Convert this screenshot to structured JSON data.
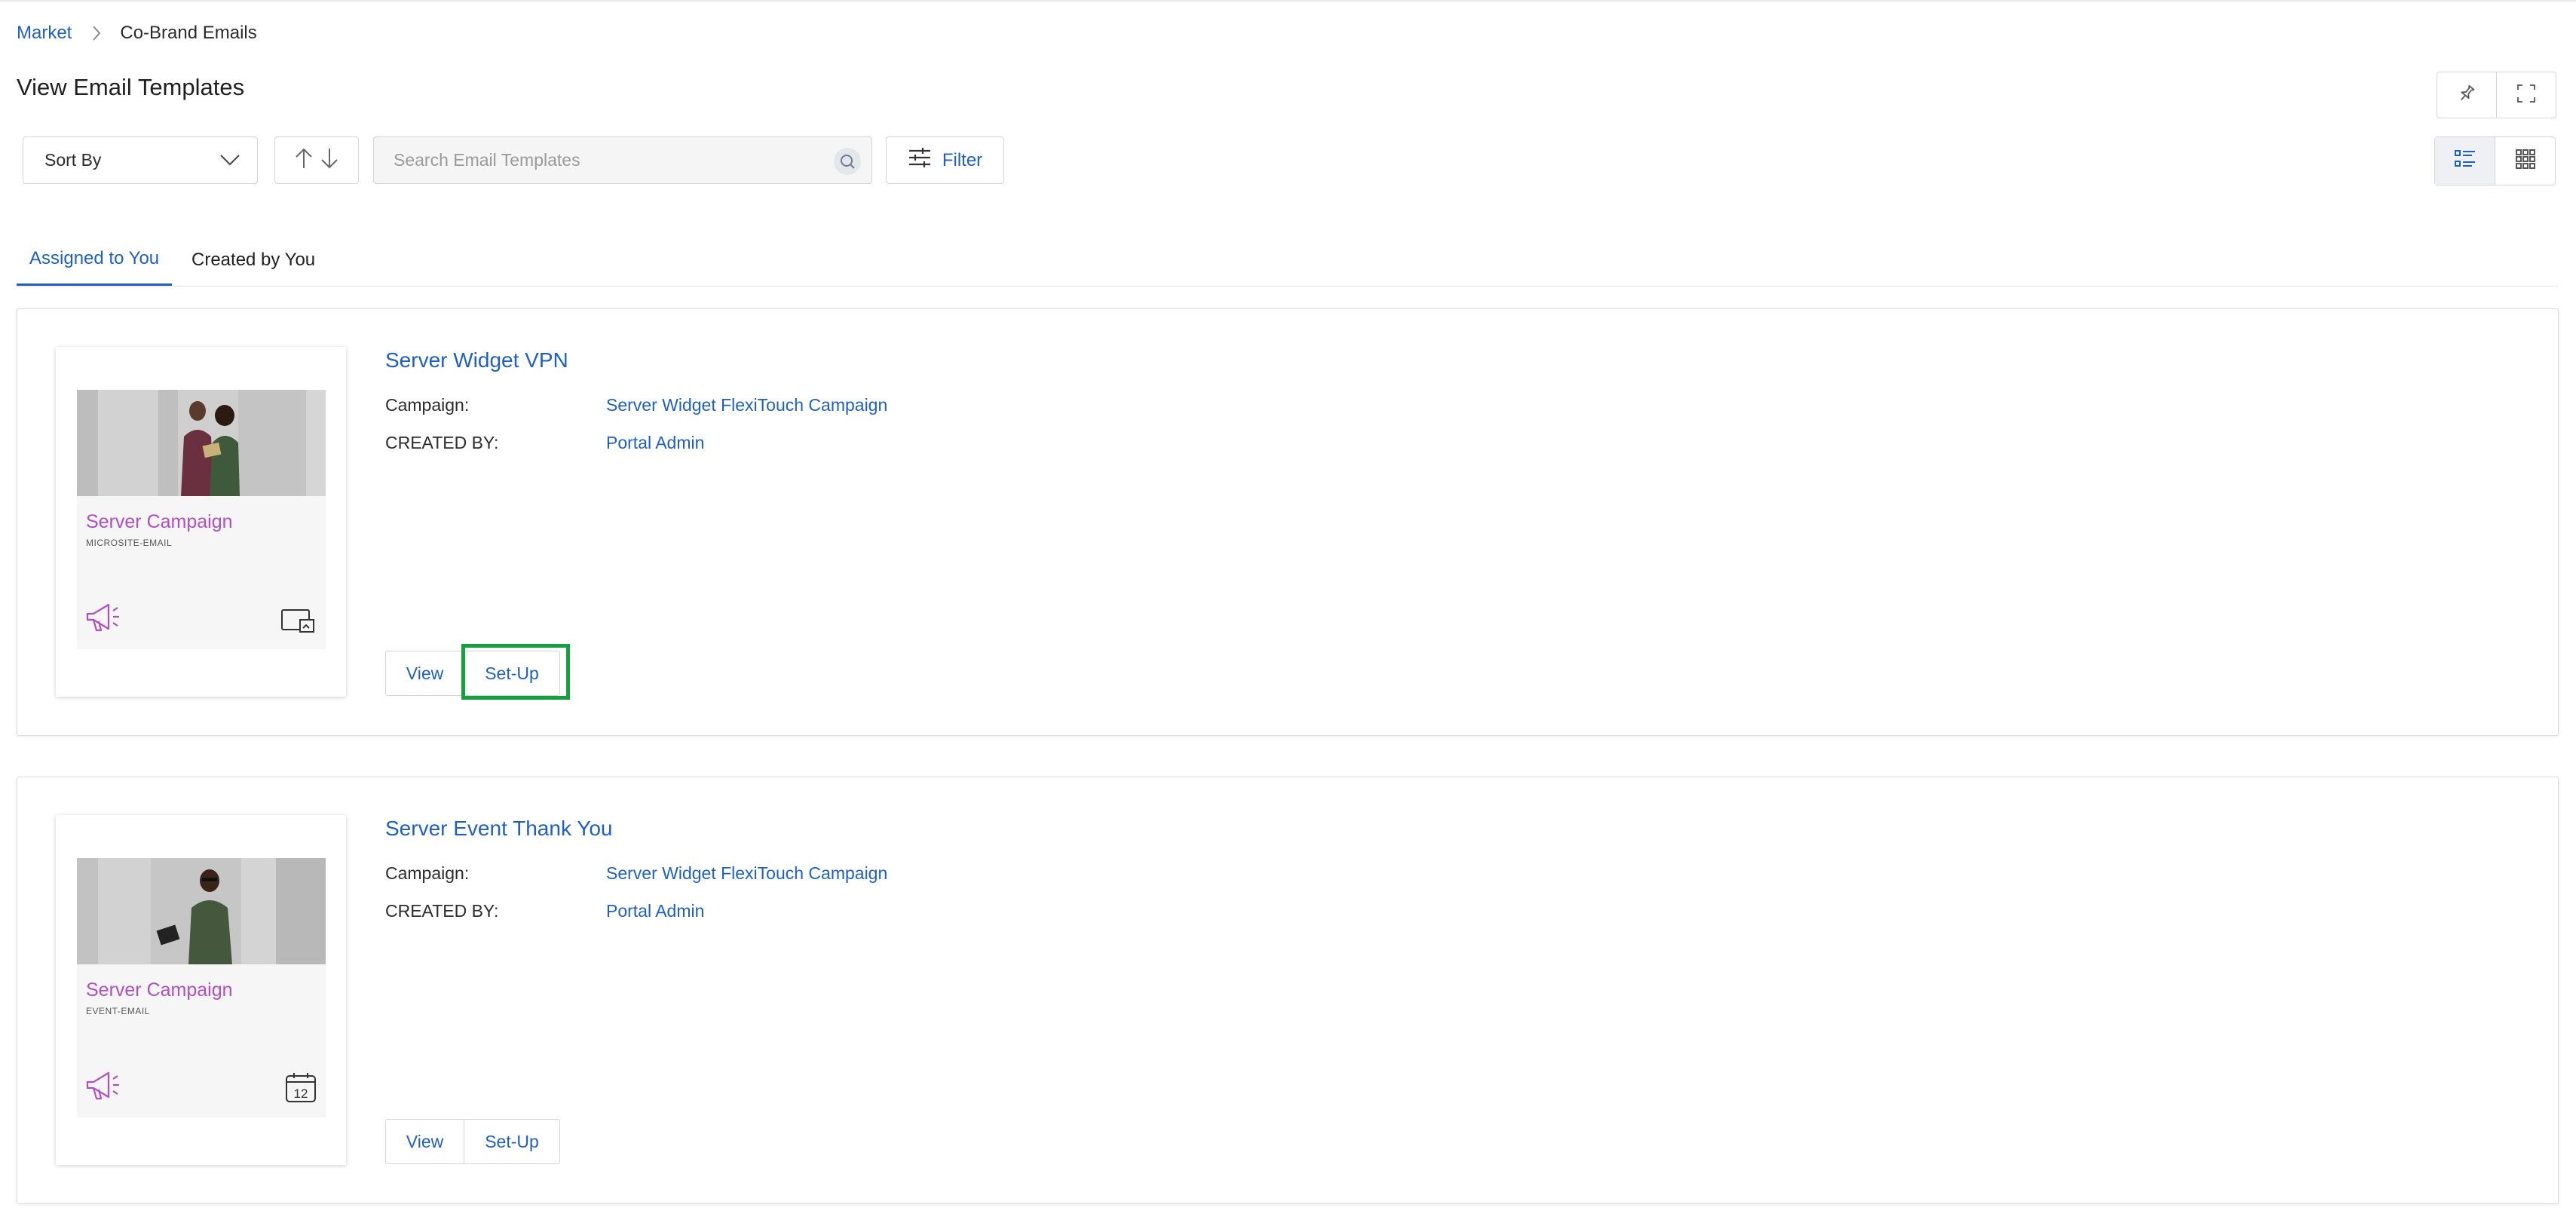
{
  "breadcrumb": {
    "items": [
      "Market",
      "Co-Brand Emails"
    ]
  },
  "page": {
    "title": "View Email Templates"
  },
  "toolbar": {
    "sort_label": "Sort By",
    "search_placeholder": "Search Email Templates",
    "filter_label": "Filter"
  },
  "tabs": [
    {
      "label": "Assigned to You",
      "active": true
    },
    {
      "label": "Created by You",
      "active": false
    }
  ],
  "labels": {
    "campaign": "Campaign:",
    "created_by": "CREATED BY:",
    "view": "View",
    "setup": "Set-Up"
  },
  "templates": [
    {
      "title": "Server Widget VPN",
      "campaign": "Server Widget FlexiTouch Campaign",
      "created_by": "Portal Admin",
      "thumb_brand": "Server Campaign",
      "thumb_type": "MICROSITE-EMAIL",
      "thumb_corner_icon": "device-icon",
      "setup_highlighted": true
    },
    {
      "title": "Server Event Thank You",
      "campaign": "Server Widget FlexiTouch Campaign",
      "created_by": "Portal Admin",
      "thumb_brand": "Server Campaign",
      "thumb_type": "EVENT-EMAIL",
      "thumb_corner_icon": "calendar-icon",
      "thumb_corner_text": "12",
      "setup_highlighted": false
    }
  ],
  "colors": {
    "link": "#1e5fc7",
    "brand": "#b04ec4",
    "highlight": "#14a03c"
  }
}
